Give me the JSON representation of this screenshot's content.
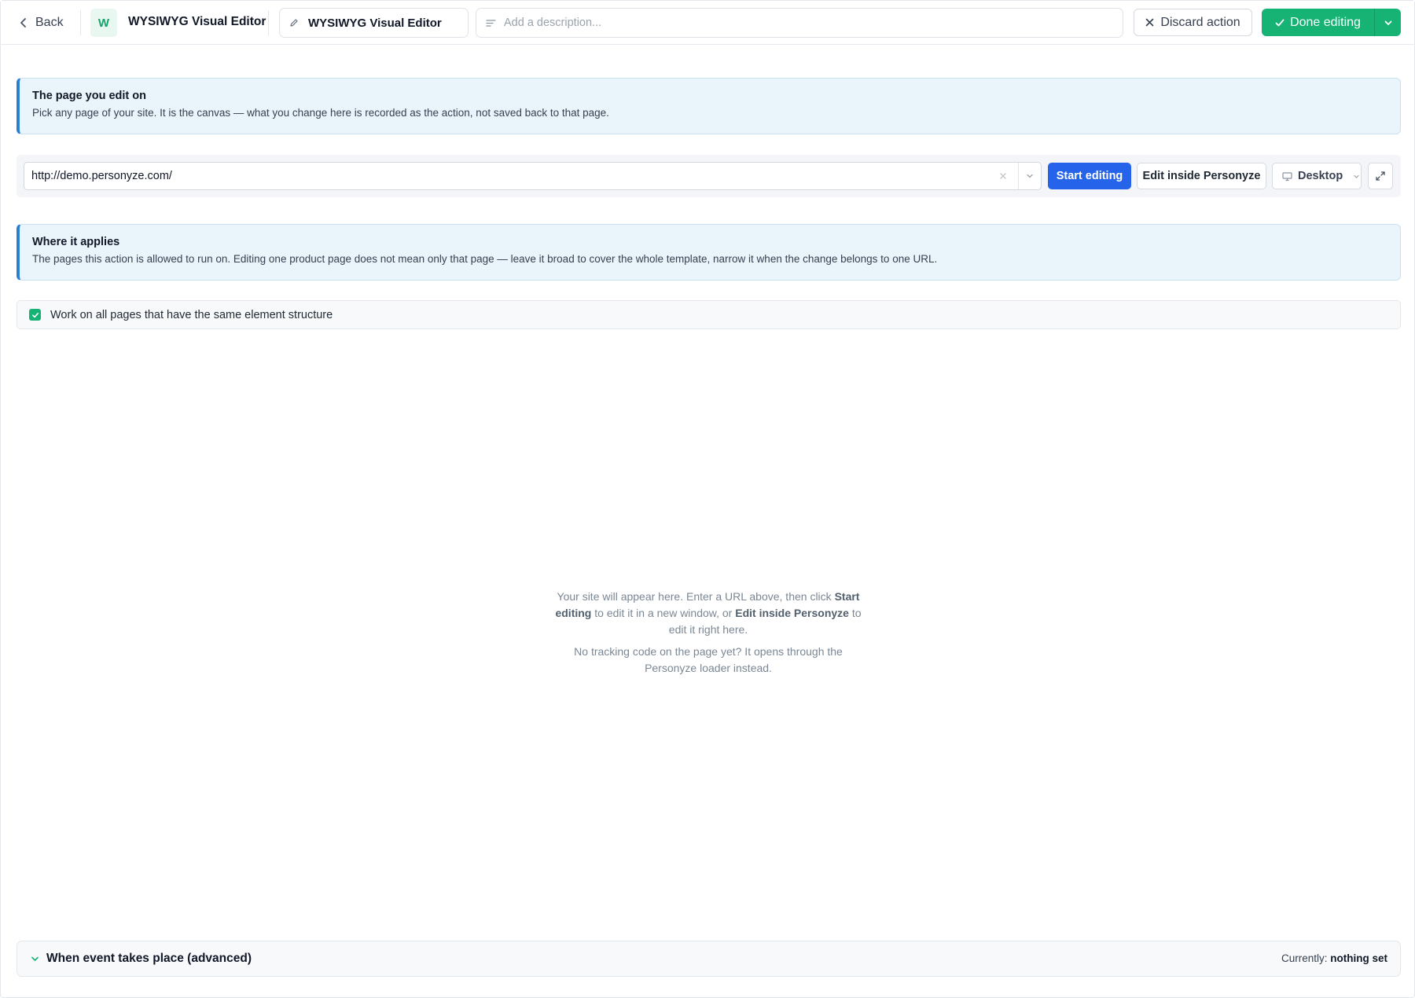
{
  "header": {
    "back_label": "Back",
    "logo_letter": "W",
    "app_title": "WYSIWYG Visual Editor",
    "name_value": "WYSIWYG Visual Editor",
    "description_placeholder": "Add a description...",
    "discard_label": "Discard action",
    "done_label": "Done editing",
    "icons": [
      "chevron-left-icon",
      "pencil-icon",
      "text-lines-icon",
      "close-icon",
      "check-icon",
      "chevron-down-icon"
    ]
  },
  "canvas_panel": {
    "title": "The page you edit on",
    "text": "Pick any page of your site. It is the canvas — what you change here is recorded as the action, not saved back to that page."
  },
  "url_bar": {
    "url_value": "http://demo.personyze.com/",
    "start_label": "Start editing",
    "inside_label": "Edit inside Personyze",
    "device_label": "Desktop",
    "icons": [
      "clear-icon",
      "chevron-down-icon",
      "monitor-icon",
      "expand-icon"
    ]
  },
  "applies_panel": {
    "title": "Where it applies",
    "text": "The pages this action is allowed to run on. Editing one product page does not mean only that page — leave it broad to cover the whole template, narrow it when the change belongs to one URL."
  },
  "same_structure": {
    "label": "Work on all pages that have the same element structure",
    "checked": true
  },
  "placeholder": {
    "p1_a": "Your site will appear here. Enter a URL above, then click ",
    "p1_b": "Start editing",
    "p1_c": " to edit it in a new window, or ",
    "p1_d": "Edit inside Personyze",
    "p1_e": " to edit it right here.",
    "p2": "No tracking code on the page yet? It opens through the Personyze loader instead."
  },
  "advanced": {
    "title": "When event takes place (advanced)",
    "currently_label": "Currently:",
    "currently_value": "nothing set"
  },
  "colors": {
    "accent_green": "#16b374",
    "primary_blue": "#2563eb",
    "info_bg": "#e9f4fb",
    "info_border": "#2b7fd0"
  }
}
